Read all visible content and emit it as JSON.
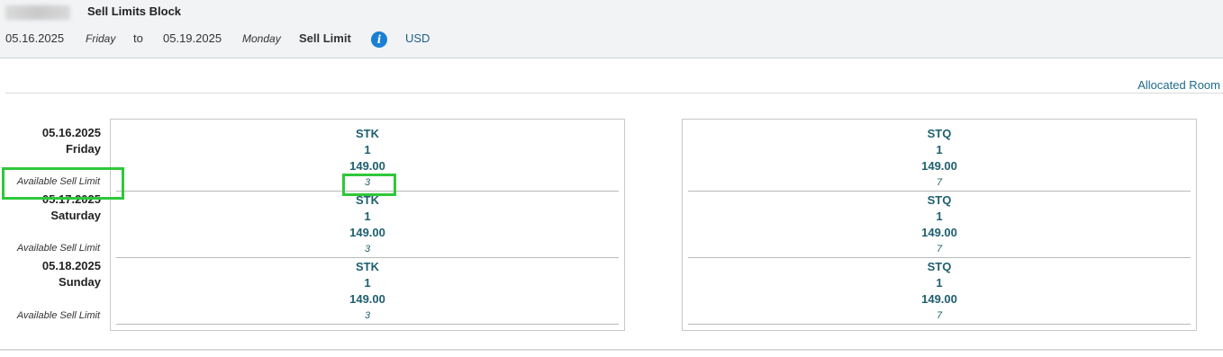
{
  "header": {
    "title": "Sell Limits Block",
    "start_date": "05.16.2025",
    "start_day": "Friday",
    "to_label": "to",
    "end_date": "05.19.2025",
    "end_day": "Monday",
    "sell_limit_label": "Sell Limit",
    "currency": "USD"
  },
  "links": {
    "allocated_room": "Allocated Room"
  },
  "available_label": "Available Sell Limit",
  "dates": [
    {
      "date": "05.16.2025",
      "day": "Friday"
    },
    {
      "date": "05.17.2025",
      "day": "Saturday"
    },
    {
      "date": "05.18.2025",
      "day": "Sunday"
    }
  ],
  "rooms": [
    {
      "code": "STK",
      "rows": [
        {
          "code": "STK",
          "qty": "1",
          "rate": "149.00",
          "available": "3"
        },
        {
          "code": "STK",
          "qty": "1",
          "rate": "149.00",
          "available": "3"
        },
        {
          "code": "STK",
          "qty": "1",
          "rate": "149.00",
          "available": "3"
        }
      ]
    },
    {
      "code": "STQ",
      "rows": [
        {
          "code": "STQ",
          "qty": "1",
          "rate": "149.00",
          "available": "7"
        },
        {
          "code": "STQ",
          "qty": "1",
          "rate": "149.00",
          "available": "7"
        },
        {
          "code": "STQ",
          "qty": "1",
          "rate": "149.00",
          "available": "7"
        }
      ]
    }
  ],
  "colors": {
    "highlight": "#2ec83a",
    "info": "#1a7fd4",
    "link": "#1e6a8a"
  }
}
